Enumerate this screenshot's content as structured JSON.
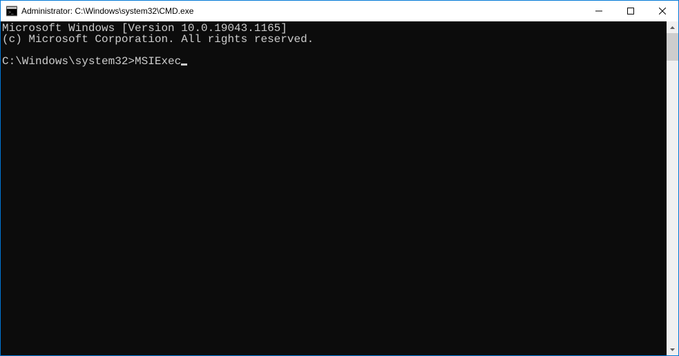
{
  "window": {
    "title": "Administrator: C:\\Windows\\system32\\CMD.exe"
  },
  "terminal": {
    "line1": "Microsoft Windows [Version 10.0.19043.1165]",
    "line2": "(c) Microsoft Corporation. All rights reserved.",
    "blank": "",
    "prompt": "C:\\Windows\\system32>",
    "input": "MSIExec"
  }
}
